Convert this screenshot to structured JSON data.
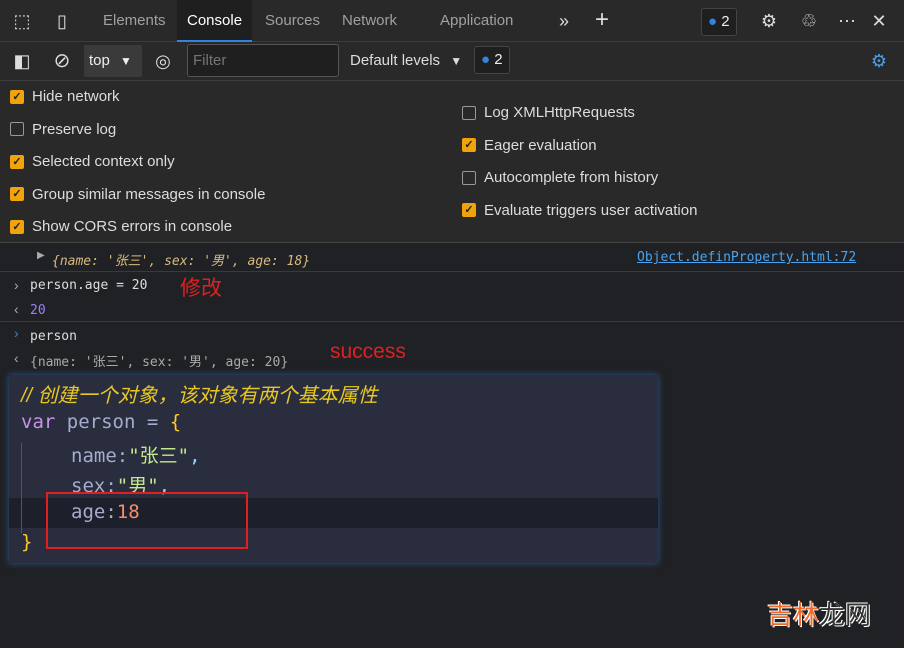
{
  "tabs": [
    "Elements",
    "Console",
    "Sources",
    "Network",
    "Application"
  ],
  "active_tab": "Console",
  "issues_count": "2",
  "toolbar": {
    "context": "top",
    "filter_placeholder": "Filter",
    "levels": "Default levels",
    "messages_count": "2"
  },
  "settings_left": [
    {
      "label": "Hide network",
      "checked": true
    },
    {
      "label": "Preserve log",
      "checked": false
    },
    {
      "label": "Selected context only",
      "checked": true
    },
    {
      "label": "Group similar messages in console",
      "checked": true
    },
    {
      "label": "Show CORS errors in console",
      "checked": true
    }
  ],
  "settings_right": [
    {
      "label": "Log XMLHttpRequests",
      "checked": false
    },
    {
      "label": "Eager evaluation",
      "checked": true
    },
    {
      "label": "Autocomplete from history",
      "checked": false
    },
    {
      "label": "Evaluate triggers user activation",
      "checked": true
    }
  ],
  "console": {
    "log1": "{name: '张三', sex: '男', age: 18}",
    "log1_source": "Object.definProperty.html:72",
    "input1": "person.age = 20",
    "note1": "修改",
    "result1": "20",
    "input2": "person",
    "result2": "{name: '张三', sex: '男', age: 20}",
    "note2": "success"
  },
  "code": {
    "comment": "// 创建一个对象，该对象有两个基本属性",
    "l1_kw": "var",
    "l1_rest": " person = ",
    "l1_brace": "{",
    "l2_key": "name:",
    "l2_val": "\"张三\"",
    "l2_end": ",",
    "l3_key": "sex:",
    "l3_val": "\"男\"",
    "l3_end": ",",
    "l4_key": "age:",
    "l4_val": "18",
    "l5": "}"
  },
  "watermark": "吉林龙网",
  "colors": {
    "accent": "#2f86e0",
    "checkbox": "#f0a30a",
    "annotation": "#e02020"
  }
}
